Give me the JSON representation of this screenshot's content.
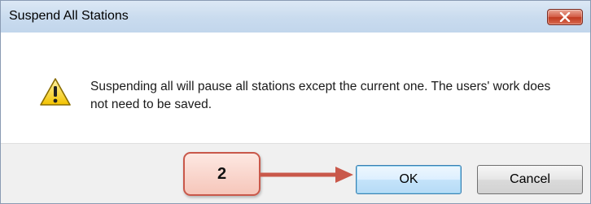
{
  "dialog": {
    "title": "Suspend All Stations",
    "message": "Suspending all will pause all stations except the current one. The users' work does not need to be saved.",
    "icon": "warning-icon",
    "buttons": {
      "ok_label": "OK",
      "cancel_label": "Cancel"
    }
  },
  "annotation": {
    "step_label": "2"
  },
  "colors": {
    "close_button": "#c9452b",
    "callout_border": "#c9584a",
    "callout_fill": "#f8d2c8",
    "arrow": "#c9584a",
    "ok_border": "#3c7fb1"
  }
}
